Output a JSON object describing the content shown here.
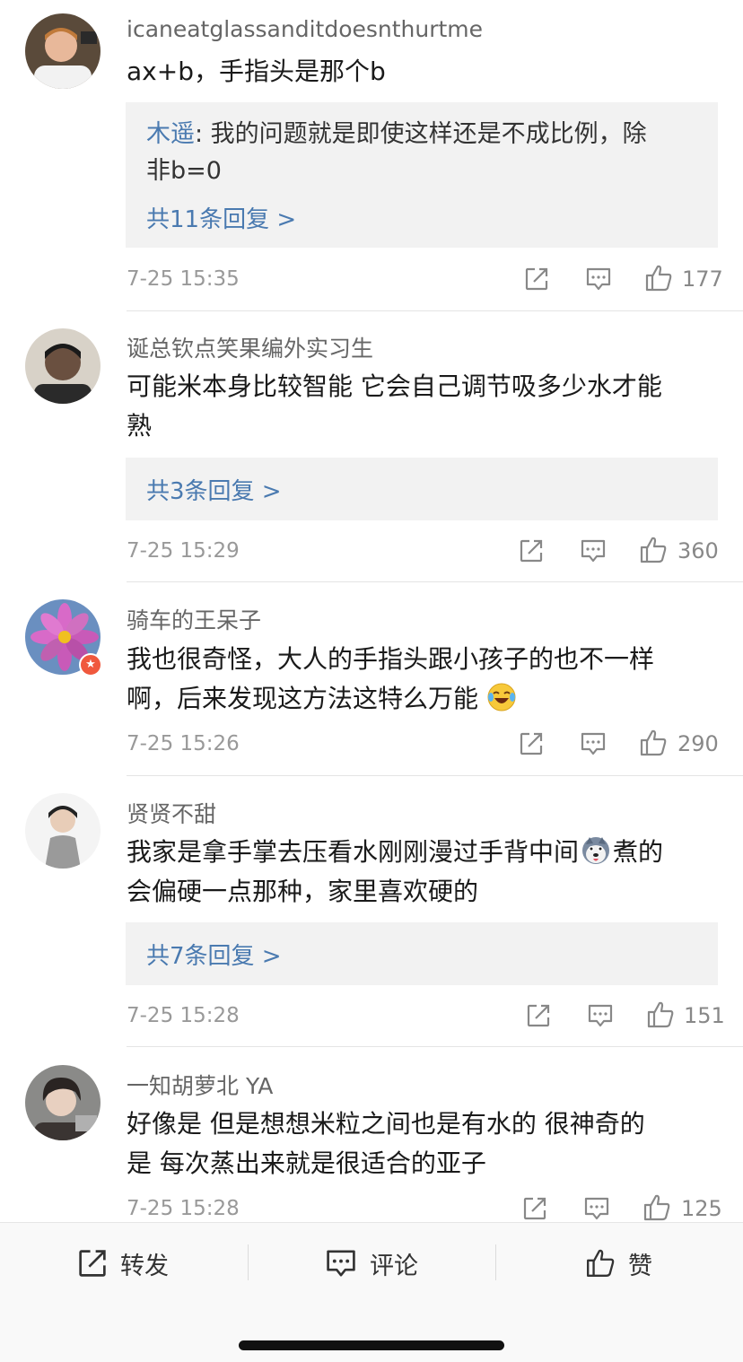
{
  "comments": [
    {
      "username": "icaneatglassanditdoesnthurtme",
      "text": "ax+b，手指头是那个b",
      "reply_user": "木遥",
      "reply_text_1": ": 我的问题就是即使这样还是不成比例，除",
      "reply_text_2": "非b=0",
      "reply_count": "共11条回复 >",
      "time": "7-25 15:35",
      "likes": "177"
    },
    {
      "username": "诞总钦点笑果编外实习生",
      "text_line1": "可能米本身比较智能  它会自己调节吸多少水才能",
      "text_line2": "熟",
      "reply_count": "共3条回复 >",
      "time": "7-25 15:29",
      "likes": "360"
    },
    {
      "username": "骑车的王呆子",
      "text_line1": "我也很奇怪，大人的手指头跟小孩子的也不一样",
      "text_line2": "啊，后来发现这方法这特么万能",
      "emoji": "laughing-crying-emoji",
      "time": "7-25 15:26",
      "likes": "290"
    },
    {
      "username": "贤贤不甜",
      "text_line1_a": "我家是拿手掌去压看水刚刚漫过手背中间",
      "emoji": "husky-emoji",
      "text_line1_b": "煮的",
      "text_line2": "会偏硬一点那种，家里喜欢硬的",
      "reply_count": "共7条回复 >",
      "time": "7-25 15:28",
      "likes": "151"
    },
    {
      "username": "一知胡萝北 YA",
      "text_line1": "好像是  但是想想米粒之间也是有水的  很神奇的",
      "text_line2": "是 每次蒸出来就是很适合的亚子",
      "time": "7-25 15:28",
      "likes": "125"
    }
  ],
  "bottom_bar": {
    "repost_label": "转发",
    "comment_label": "评论",
    "like_label": "赞"
  },
  "colors": {
    "link_blue": "#4a7ab0",
    "meta_gray": "#999999",
    "reply_bg": "#f2f2f2",
    "badge_red": "#f0583d"
  }
}
